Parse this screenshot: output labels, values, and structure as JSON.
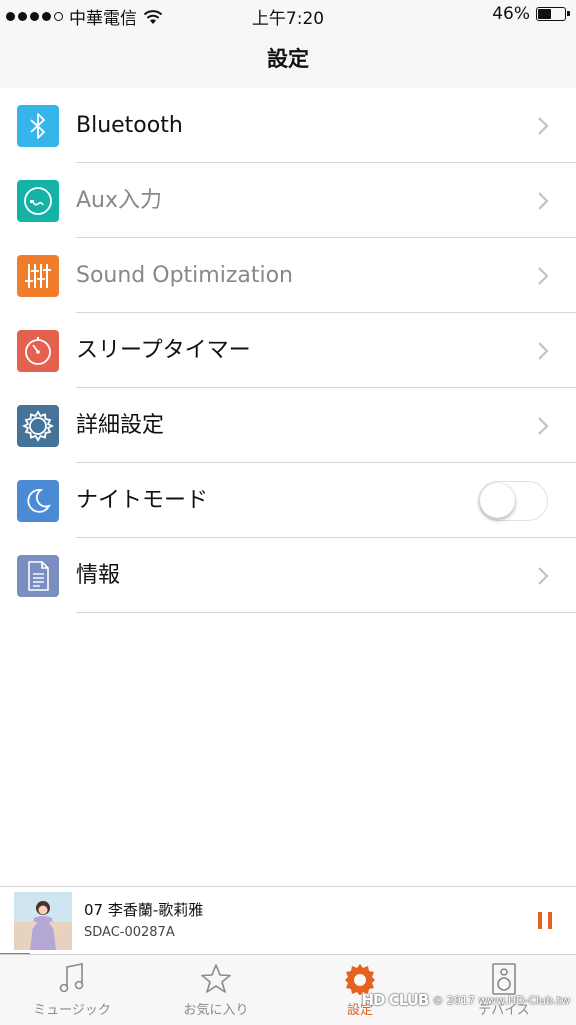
{
  "status_bar": {
    "carrier": "中華電信",
    "time": "上午7:20",
    "battery_percent": "46%",
    "battery_level": 0.46,
    "signal_bars_filled": 4,
    "signal_bars_total": 5
  },
  "nav": {
    "title": "設定"
  },
  "settings": {
    "items": [
      {
        "label": "Bluetooth",
        "icon": "bluetooth-icon",
        "color": "#35b5ea",
        "enabled": true,
        "accessory": "chevron"
      },
      {
        "label": "Aux入力",
        "icon": "aux-cable-icon",
        "color": "#14b3a6",
        "enabled": false,
        "accessory": "chevron"
      },
      {
        "label": "Sound Optimization",
        "icon": "equalizer-icon",
        "color": "#f07d2b",
        "enabled": false,
        "accessory": "chevron"
      },
      {
        "label": "スリープタイマー",
        "icon": "timer-icon",
        "color": "#e5614f",
        "enabled": true,
        "accessory": "chevron"
      },
      {
        "label": "詳細設定",
        "icon": "gear-icon",
        "color": "#46739a",
        "enabled": true,
        "accessory": "chevron"
      },
      {
        "label": "ナイトモード",
        "icon": "moon-icon",
        "color": "#4b8bd6",
        "enabled": true,
        "accessory": "toggle",
        "toggle_on": false
      },
      {
        "label": "情報",
        "icon": "document-icon",
        "color": "#7a8fc0",
        "enabled": true,
        "accessory": "chevron"
      }
    ]
  },
  "now_playing": {
    "title": "07 李香蘭-歌莉雅",
    "source": "SDAC-00287A",
    "state": "playing",
    "accent": "#e5611f"
  },
  "tabs": [
    {
      "label": "ミュージック",
      "icon": "music-note-icon",
      "active": false
    },
    {
      "label": "お気に入り",
      "icon": "star-icon",
      "active": false
    },
    {
      "label": "設定",
      "icon": "gear-icon",
      "active": true
    },
    {
      "label": "デバイス",
      "icon": "speaker-icon",
      "active": false
    }
  ],
  "watermark": {
    "logo": "HD CLUB",
    "text": "© 2017 www.HD-Club.tw"
  }
}
